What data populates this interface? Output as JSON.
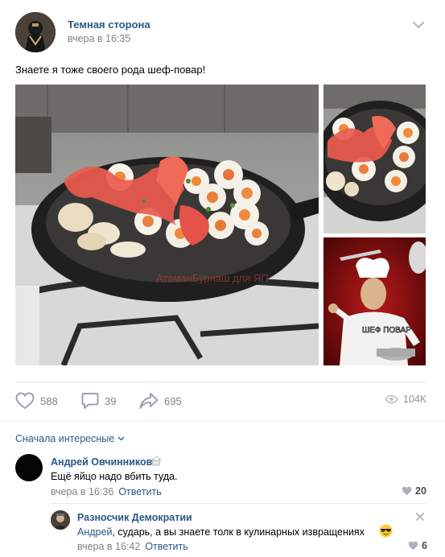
{
  "post": {
    "author": "Темная сторона",
    "time": "вчера в 16:35",
    "text": "Знаете я тоже своего рода шеф-повар!",
    "watermark": "АтаманБурнаш для ЯП",
    "meme_caption": "ШЕФ ПОВАР"
  },
  "actions": {
    "likes": "588",
    "comments": "39",
    "shares": "695",
    "views": "104K"
  },
  "comments_sort": "Сначала интересные",
  "comments": [
    {
      "author": "Андрей Овчинников",
      "text": "Ещё яйцо надо вбить туда.",
      "time": "вчера в 16:36",
      "reply_label": "Ответить",
      "likes": "20"
    },
    {
      "author": "Разносчик Демократии",
      "mention": "Андрей",
      "text": ", сударь, а вы знаете толк в кулинарных извращениях",
      "time": "вчера в 16:42",
      "reply_label": "Ответить",
      "likes": "6"
    }
  ],
  "colors": {
    "link": "#2a5885",
    "muted": "#828282",
    "divider": "#e7e8ec"
  },
  "icons": [
    "chevron-down-icon",
    "heart-icon",
    "comment-icon",
    "share-icon",
    "eye-icon",
    "heart-small-icon",
    "close-icon",
    "emoji-icon",
    "sunglasses-emoji-icon"
  ]
}
